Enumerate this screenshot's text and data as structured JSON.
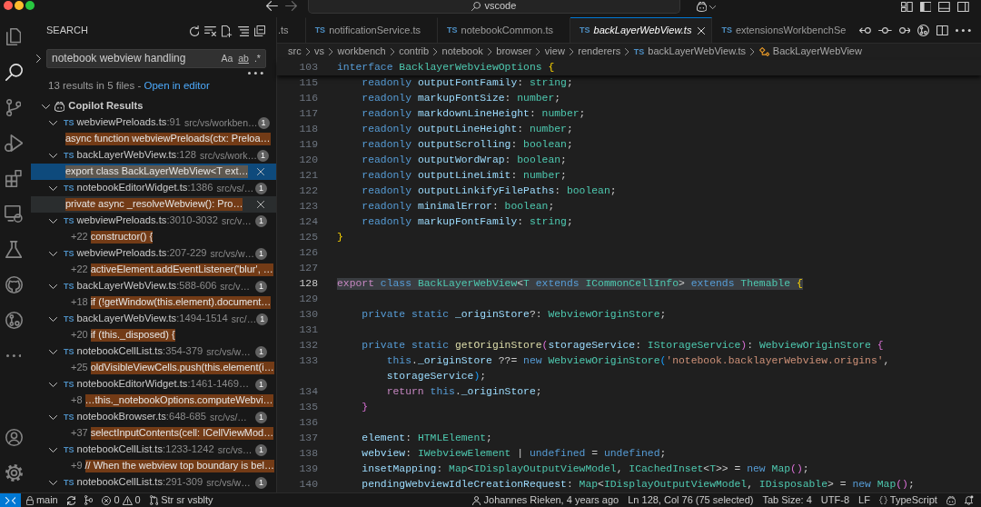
{
  "title_bar": {
    "command_center": "vscode"
  },
  "activity_bar": {
    "items": [
      {
        "kind": "explorer",
        "selected": false
      },
      {
        "kind": "search",
        "selected": true
      },
      {
        "kind": "source_control",
        "selected": false
      },
      {
        "kind": "run_debug",
        "selected": false
      },
      {
        "kind": "extensions",
        "selected": false
      },
      {
        "kind": "remote_explorer",
        "selected": false
      },
      {
        "kind": "testing",
        "selected": false
      },
      {
        "kind": "github",
        "selected": false
      },
      {
        "kind": "inspect",
        "selected": false
      },
      {
        "kind": "more",
        "selected": false
      }
    ],
    "bottom_items": [
      {
        "kind": "accounts"
      },
      {
        "kind": "manage"
      }
    ]
  },
  "search_view": {
    "title": "SEARCH",
    "replace_expanded": false,
    "query": "notebook webview handling",
    "options": [
      {
        "kind": "match_case",
        "label": "Aa"
      },
      {
        "kind": "whole_word",
        "label": "ab"
      },
      {
        "kind": "regex",
        "label": ".*"
      }
    ],
    "summary": "13 results in 5 files - ",
    "summary_link": "Open in editor",
    "groups": [
      {
        "label": "Copilot Results",
        "expanded": true,
        "selected": false,
        "files": [
          {
            "icon_label": "TS",
            "name": "webviewPreloads.ts",
            "line_ref": ":91",
            "path": "src/vs/workben…",
            "count": "1",
            "expanded": true,
            "selected": false,
            "matches": [
              {
                "text": "async function webviewPreloads(ctx: Preloa…",
                "selected": false,
                "hovered": false
              }
            ]
          },
          {
            "icon_label": "TS",
            "name": "backLayerWebView.ts",
            "line_ref": ":128",
            "path": "src/vs/work…",
            "count": "1",
            "expanded": true,
            "selected": false,
            "matches": [
              {
                "text": "export class BackLayerWebView<T ext…",
                "selected": true,
                "hovered": false
              }
            ]
          },
          {
            "icon_label": "TS",
            "name": "notebookEditorWidget.ts",
            "line_ref": ":1386",
            "path": "src/vs/…",
            "count": "1",
            "expanded": true,
            "selected": false,
            "matches": [
              {
                "text": "private async _resolveWebview(): Pro…",
                "selected": false,
                "hovered": true
              }
            ]
          },
          {
            "icon_label": "TS",
            "name": "webviewPreloads.ts",
            "line_ref": ":3010-3032",
            "path": "src/v…",
            "count": "1",
            "expanded": true,
            "selected": false,
            "matches": [
              {
                "prefix": "+22",
                "text": "constructor() {",
                "selected": false,
                "hovered": false
              }
            ]
          },
          {
            "icon_label": "TS",
            "name": "webviewPreloads.ts",
            "line_ref": ":207-229",
            "path": "src/vs/w…",
            "count": "1",
            "expanded": true,
            "selected": false,
            "matches": [
              {
                "prefix": "+22",
                "text": "activeElement.addEventListener('blur', …",
                "selected": false,
                "hovered": false
              }
            ]
          },
          {
            "icon_label": "TS",
            "name": "backLayerWebView.ts",
            "line_ref": ":588-606",
            "path": "src/v…",
            "count": "1",
            "expanded": true,
            "selected": false,
            "matches": [
              {
                "prefix": "+18",
                "text": "if (!getWindow(this.element).document…",
                "selected": false,
                "hovered": false
              }
            ]
          },
          {
            "icon_label": "TS",
            "name": "backLayerWebView.ts",
            "line_ref": ":1494-1514",
            "path": "src/…",
            "count": "1",
            "expanded": true,
            "selected": false,
            "matches": [
              {
                "prefix": "+20",
                "text": "if (this._disposed) {",
                "selected": false,
                "hovered": false
              }
            ]
          },
          {
            "icon_label": "TS",
            "name": "notebookCellList.ts",
            "line_ref": ":354-379",
            "path": "src/vs/w…",
            "count": "1",
            "expanded": true,
            "selected": false,
            "matches": [
              {
                "prefix": "+25",
                "text": "oldVisibleViewCells.push(this.element(i…",
                "selected": false,
                "hovered": false
              }
            ]
          },
          {
            "icon_label": "TS",
            "name": "notebookEditorWidget.ts",
            "line_ref": ":1461-1469…",
            "count": "1",
            "expanded": true,
            "selected": false,
            "matches": [
              {
                "prefix": "+8",
                "text": "…this._notebookOptions.computeWebvi…",
                "selected": false,
                "hovered": false
              }
            ]
          },
          {
            "icon_label": "TS",
            "name": "notebookBrowser.ts",
            "line_ref": ":648-685",
            "path": "src/vs/…",
            "count": "1",
            "expanded": true,
            "selected": false,
            "matches": [
              {
                "prefix": "+37",
                "text": "selectInputContents(cell: ICellViewMod…",
                "selected": false,
                "hovered": false
              }
            ]
          },
          {
            "icon_label": "TS",
            "name": "notebookCellList.ts",
            "line_ref": ":1233-1242",
            "path": "src/vs…",
            "count": "1",
            "expanded": true,
            "selected": false,
            "matches": [
              {
                "prefix": "+9",
                "text": "// When the webview top boundary is bel…",
                "selected": false,
                "hovered": false
              }
            ]
          },
          {
            "icon_label": "TS",
            "name": "notebookCellList.ts",
            "line_ref": ":291-309",
            "path": "src/vs/w…",
            "count": "1",
            "expanded": true,
            "selected": false
          }
        ]
      }
    ]
  },
  "editor": {
    "tabs": [
      {
        "label": ".ts",
        "selected": false,
        "preview": false
      },
      {
        "icon_label": "TS",
        "label": "notificationService.ts",
        "selected": false,
        "preview": false
      },
      {
        "icon_label": "TS",
        "label": "notebookCommon.ts",
        "selected": false,
        "preview": false
      },
      {
        "icon_label": "TS",
        "label": "backLayerWebView.ts",
        "selected": true,
        "preview": true
      },
      {
        "icon_label": "TS",
        "label": "extensionsWorkbenchSe",
        "selected": false,
        "preview": false
      }
    ],
    "breadcrumbs": [
      {
        "kind": "folder",
        "label": "src"
      },
      {
        "kind": "folder",
        "label": "vs"
      },
      {
        "kind": "folder",
        "label": "workbench"
      },
      {
        "kind": "folder",
        "label": "contrib"
      },
      {
        "kind": "folder",
        "label": "notebook"
      },
      {
        "kind": "folder",
        "label": "browser"
      },
      {
        "kind": "folder",
        "label": "view"
      },
      {
        "kind": "folder",
        "label": "renderers"
      },
      {
        "kind": "file",
        "icon_label": "TS",
        "label": "backLayerWebView.ts"
      },
      {
        "kind": "class",
        "label": "BackLayerWebView"
      }
    ],
    "sticky_scroll": {
      "number": "103",
      "segments": [
        {
          "text": "interface ",
          "kind": "keyword"
        },
        {
          "text": "BacklayerWebviewOptions ",
          "kind": "type"
        },
        {
          "text": "{",
          "kind": "bracket1"
        }
      ]
    },
    "lines": [
      {
        "number": "115",
        "selected": false,
        "segments": [
          {
            "text": "    readonly ",
            "kind": "keyword"
          },
          {
            "text": "outputFontFamily",
            "kind": "property"
          },
          {
            "text": ": ",
            "kind": "punct"
          },
          {
            "text": "string",
            "kind": "type"
          },
          {
            "text": ";",
            "kind": "punct"
          }
        ]
      },
      {
        "number": "116",
        "selected": false,
        "segments": [
          {
            "text": "    readonly ",
            "kind": "keyword"
          },
          {
            "text": "markupFontSize",
            "kind": "property"
          },
          {
            "text": ": ",
            "kind": "punct"
          },
          {
            "text": "number",
            "kind": "type"
          },
          {
            "text": ";",
            "kind": "punct"
          }
        ]
      },
      {
        "number": "117",
        "selected": false,
        "segments": [
          {
            "text": "    readonly ",
            "kind": "keyword"
          },
          {
            "text": "markdownLineHeight",
            "kind": "property"
          },
          {
            "text": ": ",
            "kind": "punct"
          },
          {
            "text": "number",
            "kind": "type"
          },
          {
            "text": ";",
            "kind": "punct"
          }
        ]
      },
      {
        "number": "118",
        "selected": false,
        "segments": [
          {
            "text": "    readonly ",
            "kind": "keyword"
          },
          {
            "text": "outputLineHeight",
            "kind": "property"
          },
          {
            "text": ": ",
            "kind": "punct"
          },
          {
            "text": "number",
            "kind": "type"
          },
          {
            "text": ";",
            "kind": "punct"
          }
        ]
      },
      {
        "number": "119",
        "selected": false,
        "segments": [
          {
            "text": "    readonly ",
            "kind": "keyword"
          },
          {
            "text": "outputScrolling",
            "kind": "property"
          },
          {
            "text": ": ",
            "kind": "punct"
          },
          {
            "text": "boolean",
            "kind": "type"
          },
          {
            "text": ";",
            "kind": "punct"
          }
        ]
      },
      {
        "number": "120",
        "selected": false,
        "segments": [
          {
            "text": "    readonly ",
            "kind": "keyword"
          },
          {
            "text": "outputWordWrap",
            "kind": "property"
          },
          {
            "text": ": ",
            "kind": "punct"
          },
          {
            "text": "boolean",
            "kind": "type"
          },
          {
            "text": ";",
            "kind": "punct"
          }
        ]
      },
      {
        "number": "121",
        "selected": false,
        "segments": [
          {
            "text": "    readonly ",
            "kind": "keyword"
          },
          {
            "text": "outputLineLimit",
            "kind": "property"
          },
          {
            "text": ": ",
            "kind": "punct"
          },
          {
            "text": "number",
            "kind": "type"
          },
          {
            "text": ";",
            "kind": "punct"
          }
        ]
      },
      {
        "number": "122",
        "selected": false,
        "segments": [
          {
            "text": "    readonly ",
            "kind": "keyword"
          },
          {
            "text": "outputLinkifyFilePaths",
            "kind": "property"
          },
          {
            "text": ": ",
            "kind": "punct"
          },
          {
            "text": "boolean",
            "kind": "type"
          },
          {
            "text": ";",
            "kind": "punct"
          }
        ]
      },
      {
        "number": "123",
        "selected": false,
        "segments": [
          {
            "text": "    readonly ",
            "kind": "keyword"
          },
          {
            "text": "minimalError",
            "kind": "property"
          },
          {
            "text": ": ",
            "kind": "punct"
          },
          {
            "text": "boolean",
            "kind": "type"
          },
          {
            "text": ";",
            "kind": "punct"
          }
        ]
      },
      {
        "number": "124",
        "selected": false,
        "segments": [
          {
            "text": "    readonly ",
            "kind": "keyword"
          },
          {
            "text": "markupFontFamily",
            "kind": "property"
          },
          {
            "text": ": ",
            "kind": "punct"
          },
          {
            "text": "string",
            "kind": "type"
          },
          {
            "text": ";",
            "kind": "punct"
          }
        ]
      },
      {
        "number": "125",
        "selected": false,
        "segments": [
          {
            "text": "}",
            "kind": "bracket1"
          }
        ]
      },
      {
        "number": "126",
        "selected": false
      },
      {
        "number": "127",
        "selected": false
      },
      {
        "number": "128",
        "selected": true,
        "segments": [
          {
            "text": "export ",
            "kind": "control"
          },
          {
            "text": "class ",
            "kind": "keyword"
          },
          {
            "text": "BackLayerWebView",
            "kind": "type"
          },
          {
            "text": "<",
            "kind": "punct"
          },
          {
            "text": "T ",
            "kind": "type"
          },
          {
            "text": "extends ",
            "kind": "keyword"
          },
          {
            "text": "ICommonCellInfo",
            "kind": "type"
          },
          {
            "text": "> ",
            "kind": "punct"
          },
          {
            "text": "extends ",
            "kind": "keyword"
          },
          {
            "text": "Themable ",
            "kind": "type"
          },
          {
            "text": "{",
            "kind": "bracket1"
          }
        ]
      },
      {
        "number": "129",
        "selected": false
      },
      {
        "number": "130",
        "selected": false,
        "segments": [
          {
            "text": "    private static ",
            "kind": "keyword"
          },
          {
            "text": "_originStore",
            "kind": "property"
          },
          {
            "text": "?: ",
            "kind": "punct"
          },
          {
            "text": "WebviewOriginStore",
            "kind": "type"
          },
          {
            "text": ";",
            "kind": "punct"
          }
        ]
      },
      {
        "number": "131",
        "selected": false
      },
      {
        "number": "132",
        "selected": false,
        "segments": [
          {
            "text": "    private static ",
            "kind": "keyword"
          },
          {
            "text": "getOriginStore",
            "kind": "function"
          },
          {
            "text": "(",
            "kind": "bracket2"
          },
          {
            "text": "storageService",
            "kind": "property"
          },
          {
            "text": ": ",
            "kind": "punct"
          },
          {
            "text": "IStorageService",
            "kind": "type"
          },
          {
            "text": ")",
            "kind": "bracket2"
          },
          {
            "text": ": ",
            "kind": "punct"
          },
          {
            "text": "WebviewOriginStore ",
            "kind": "type"
          },
          {
            "text": "{",
            "kind": "bracket2"
          }
        ]
      },
      {
        "number": "133",
        "selected": false,
        "segments": [
          {
            "text": "        this",
            "kind": "keyword"
          },
          {
            "text": ".",
            "kind": "punct"
          },
          {
            "text": "_originStore ",
            "kind": "property"
          },
          {
            "text": "??= ",
            "kind": "punct"
          },
          {
            "text": "new ",
            "kind": "keyword"
          },
          {
            "text": "WebviewOriginStore",
            "kind": "type"
          },
          {
            "text": "(",
            "kind": "bracket3"
          },
          {
            "text": "'notebook.backlayerWebview.origins'",
            "kind": "string"
          },
          {
            "text": ",",
            "kind": "punct"
          }
        ]
      },
      {
        "selected": false,
        "segments": [
          {
            "text": "        storageService",
            "kind": "property"
          },
          {
            "text": ")",
            "kind": "bracket3"
          },
          {
            "text": ";",
            "kind": "punct"
          }
        ]
      },
      {
        "number": "134",
        "selected": false,
        "segments": [
          {
            "text": "        return ",
            "kind": "control"
          },
          {
            "text": "this",
            "kind": "keyword"
          },
          {
            "text": ".",
            "kind": "punct"
          },
          {
            "text": "_originStore",
            "kind": "property"
          },
          {
            "text": ";",
            "kind": "punct"
          }
        ]
      },
      {
        "number": "135",
        "selected": false,
        "segments": [
          {
            "text": "    }",
            "kind": "bracket2"
          }
        ]
      },
      {
        "number": "136",
        "selected": false
      },
      {
        "number": "137",
        "selected": false,
        "segments": [
          {
            "text": "    element",
            "kind": "property"
          },
          {
            "text": ": ",
            "kind": "punct"
          },
          {
            "text": "HTMLElement",
            "kind": "type"
          },
          {
            "text": ";",
            "kind": "punct"
          }
        ]
      },
      {
        "number": "138",
        "selected": false,
        "segments": [
          {
            "text": "    webview",
            "kind": "property"
          },
          {
            "text": ": ",
            "kind": "punct"
          },
          {
            "text": "IWebviewElement ",
            "kind": "type"
          },
          {
            "text": "| ",
            "kind": "punct"
          },
          {
            "text": "undefined ",
            "kind": "keyword"
          },
          {
            "text": "= ",
            "kind": "punct"
          },
          {
            "text": "undefined",
            "kind": "keyword"
          },
          {
            "text": ";",
            "kind": "punct"
          }
        ]
      },
      {
        "number": "139",
        "selected": false,
        "segments": [
          {
            "text": "    insetMapping",
            "kind": "property"
          },
          {
            "text": ": ",
            "kind": "punct"
          },
          {
            "text": "Map",
            "kind": "type"
          },
          {
            "text": "<",
            "kind": "punct"
          },
          {
            "text": "IDisplayOutputViewModel",
            "kind": "type"
          },
          {
            "text": ", ",
            "kind": "punct"
          },
          {
            "text": "ICachedInset",
            "kind": "type"
          },
          {
            "text": "<",
            "kind": "punct"
          },
          {
            "text": "T",
            "kind": "type"
          },
          {
            "text": ">> = ",
            "kind": "punct"
          },
          {
            "text": "new ",
            "kind": "keyword"
          },
          {
            "text": "Map",
            "kind": "type"
          },
          {
            "text": "()",
            "kind": "bracket2"
          },
          {
            "text": ";",
            "kind": "punct"
          }
        ]
      },
      {
        "number": "140",
        "selected": false,
        "segments": [
          {
            "text": "    pendingWebviewIdleCreationRequest",
            "kind": "property"
          },
          {
            "text": ": ",
            "kind": "punct"
          },
          {
            "text": "Map",
            "kind": "type"
          },
          {
            "text": "<",
            "kind": "punct"
          },
          {
            "text": "IDisplayOutputViewModel",
            "kind": "type"
          },
          {
            "text": ", ",
            "kind": "punct"
          },
          {
            "text": "IDisposable",
            "kind": "type"
          },
          {
            "text": "> = ",
            "kind": "punct"
          },
          {
            "text": "new ",
            "kind": "keyword"
          },
          {
            "text": "Map",
            "kind": "type"
          },
          {
            "text": "()",
            "kind": "bracket2"
          },
          {
            "text": ";",
            "kind": "punct"
          }
        ]
      }
    ]
  },
  "status_bar": {
    "left": [
      {
        "kind": "remote"
      },
      {
        "kind": "branch",
        "text": "main"
      },
      {
        "kind": "sync"
      },
      {
        "kind": "graph"
      },
      {
        "kind": "problems",
        "errors": "0",
        "warnings": "0"
      },
      {
        "kind": "pull_request",
        "text": "Str sr vsblty"
      }
    ],
    "right": [
      {
        "kind": "blame",
        "text": "Johannes Rieken, 4 years ago"
      },
      {
        "kind": "text",
        "text": "Ln 128, Col 76 (75 selected)"
      },
      {
        "kind": "text",
        "text": "Tab Size: 4"
      },
      {
        "kind": "text",
        "text": "UTF-8"
      },
      {
        "kind": "text",
        "text": "LF"
      },
      {
        "kind": "language",
        "text": "TypeScript"
      },
      {
        "kind": "copilot"
      },
      {
        "kind": "notifications"
      }
    ]
  }
}
